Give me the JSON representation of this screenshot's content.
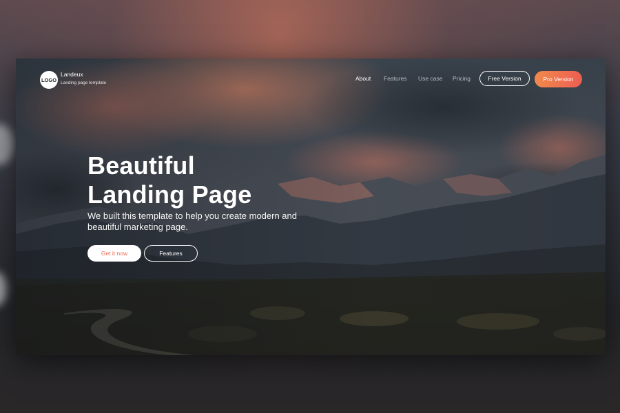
{
  "brand": {
    "logo_text": "LOGO",
    "name": "Landeux",
    "tagline": "Landing page template"
  },
  "nav": {
    "items": [
      {
        "label": "About",
        "active": true
      },
      {
        "label": "Features",
        "active": false
      },
      {
        "label": "Use case",
        "active": false
      },
      {
        "label": "Pricing",
        "active": false
      }
    ],
    "free_button": "Free Version",
    "pro_button": "Pro Version"
  },
  "hero": {
    "title_line1": "Beautiful",
    "title_line2": "Landing Page",
    "subtitle": "We built this template to help you create modern and beautiful marketing page.",
    "primary_button": "Get it now",
    "secondary_button": "Features"
  },
  "colors": {
    "accent_start": "#f28a4c",
    "accent_end": "#ec5e52",
    "accent_text": "#ef6a4f"
  }
}
